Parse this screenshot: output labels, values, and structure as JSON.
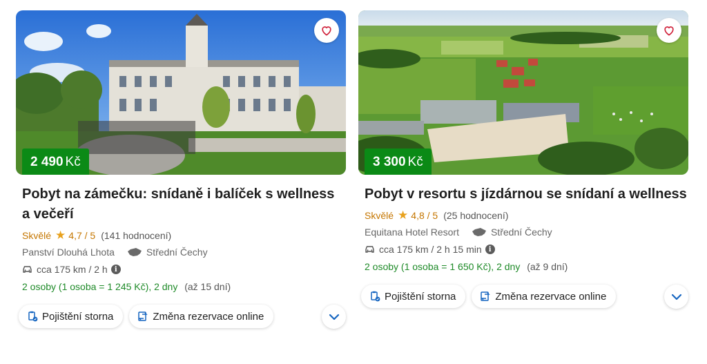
{
  "cards": [
    {
      "price": "2 490",
      "currency": "Kč",
      "title": "Pobyt na zámečku: snídaně i balíček s wellness a večeří",
      "rating_word": "Skvělé",
      "rating_value": "4,7 / 5",
      "rating_count": "(141 hodnocení)",
      "hotel": "Panství Dlouhá Lhota",
      "region": "Střední Čechy",
      "distance": "cca 175 km / 2 h",
      "persons": "2 osoby (1 osoba = 1 245 Kč), 2 dny",
      "availability": "(až 15 dní)",
      "chip1": "Pojištění storna",
      "chip2": "Změna rezervace online",
      "icons": {
        "favorite": "heart-icon",
        "map": "czech-map-icon",
        "car": "car-icon",
        "info": "info-icon",
        "insurance": "insurance-icon",
        "change": "change-icon",
        "expand": "chevron-down-icon"
      }
    },
    {
      "price": "3 300",
      "currency": "Kč",
      "title": "Pobyt v resortu s jízdárnou se snídaní a wellness",
      "rating_word": "Skvělé",
      "rating_value": "4,8 / 5",
      "rating_count": "(25 hodnocení)",
      "hotel": "Equitana Hotel Resort",
      "region": "Střední Čechy",
      "distance": "cca 175 km / 2 h 15 min",
      "persons": "2 osoby (1 osoba = 1 650 Kč), 2 dny",
      "availability": "(až 9 dní)",
      "chip1": "Pojištění storna",
      "chip2": "Změna rezervace online",
      "icons": {
        "favorite": "heart-icon",
        "map": "czech-map-icon",
        "car": "car-icon",
        "info": "info-icon",
        "insurance": "insurance-icon",
        "change": "change-icon",
        "expand": "chevron-down-icon"
      }
    }
  ],
  "colors": {
    "price_badge": "#0b8a16",
    "rating": "#c57600",
    "persons": "#1e8a28",
    "accent_blue": "#1565c0",
    "heart": "#d0233c"
  }
}
